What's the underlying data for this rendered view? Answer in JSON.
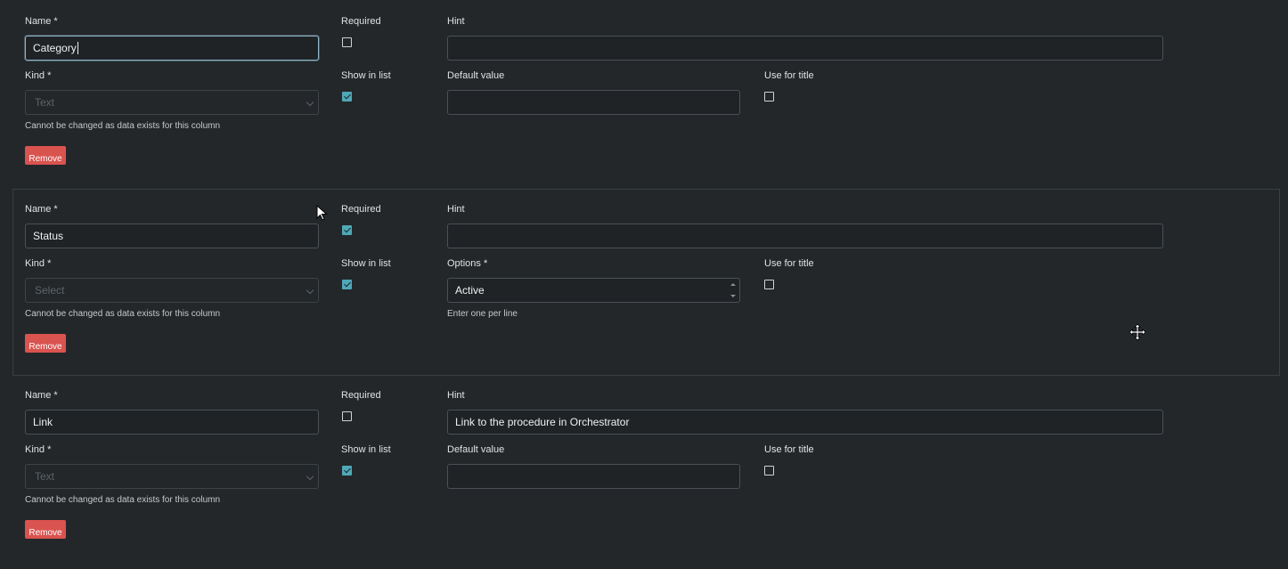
{
  "labels": {
    "name": "Name",
    "required_star": "*",
    "kind": "Kind",
    "required": "Required",
    "show_in_list": "Show in list",
    "hint": "Hint",
    "default_value": "Default value",
    "options": "Options",
    "use_for_title": "Use for title",
    "kind_locked_help": "Cannot be changed as data exists for this column",
    "options_help": "Enter one per line",
    "remove": "Remove"
  },
  "columns": [
    {
      "name": "Category",
      "kind": "Text",
      "required": false,
      "show_in_list": true,
      "hint": "",
      "default_value": "",
      "use_for_title": false
    },
    {
      "name": "Status",
      "kind": "Select",
      "required": true,
      "show_in_list": true,
      "hint": "",
      "options": "Active",
      "use_for_title": false
    },
    {
      "name": "Link",
      "kind": "Text",
      "required": false,
      "show_in_list": true,
      "hint": "Link to the procedure in Orchestrator",
      "default_value": "",
      "use_for_title": false
    }
  ],
  "colors": {
    "background": "#23272a",
    "accent": "#4fa8b8",
    "danger": "#d9534f"
  },
  "icons": {
    "pointer": "mouse-pointer-icon",
    "move": "move-cursor-icon"
  }
}
